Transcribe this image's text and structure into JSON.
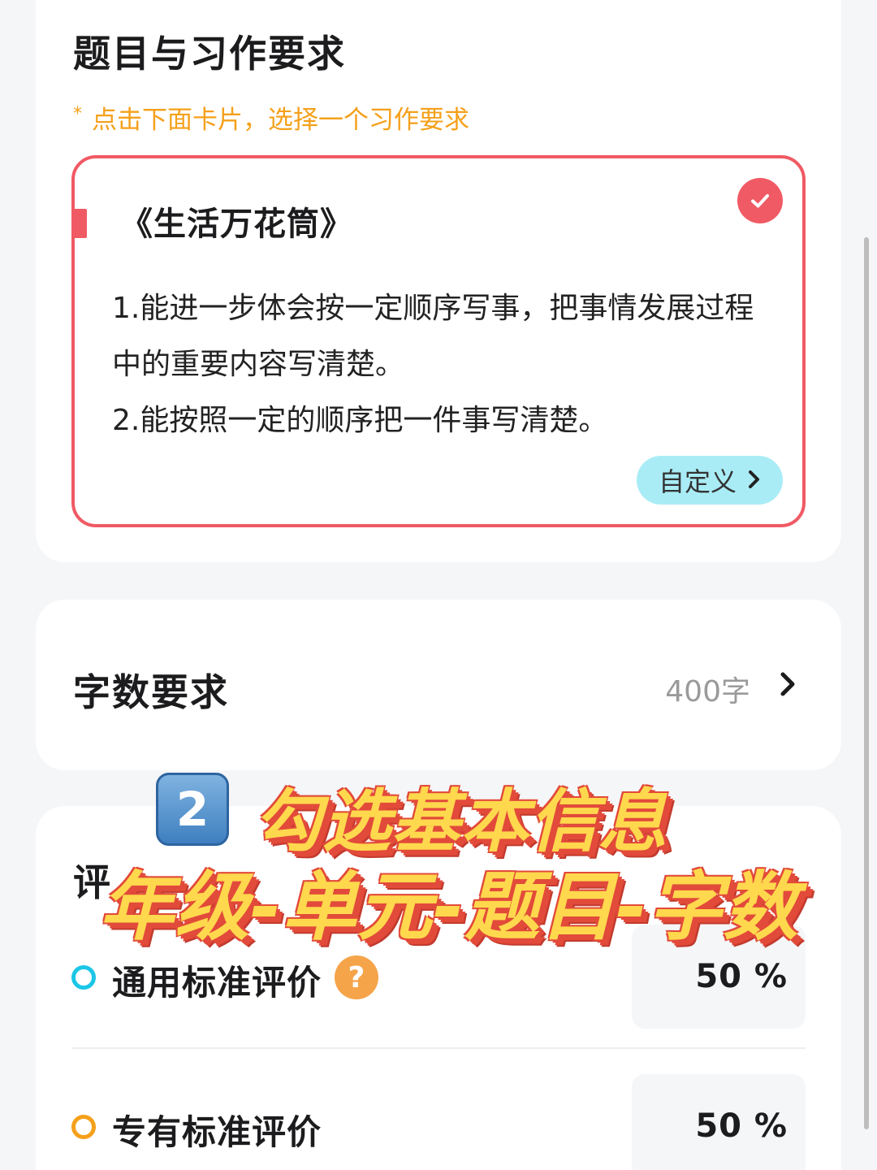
{
  "topic_section": {
    "title": "题目与习作要求",
    "hint_star": "*",
    "hint": "点击下面卡片，选择一个习作要求",
    "requirement_card": {
      "title": "《生活万花筒》",
      "line1": "1.能进一步体会按一定顺序写事，把事情发展过程中的重要内容写清楚。",
      "line2": "2.能按照一定的顺序把一件事写清楚。",
      "custom_label": "自定义",
      "selected": true
    }
  },
  "word_section": {
    "label": "字数要求",
    "value": "400字"
  },
  "eval_section": {
    "title": "评",
    "rows": [
      {
        "label": "通用标准评价",
        "percent": "50 %"
      },
      {
        "label": "专有标准评价",
        "percent": "50 %"
      }
    ]
  },
  "overlay": {
    "badge": "2",
    "line1": "勾选基本信息",
    "line2": "年级-单元-题目-字数"
  },
  "colors": {
    "accent": "#f05a64",
    "hint": "#f5a01a",
    "custom_button": "#a9ecf6",
    "dot_blue": "#1cc6e6",
    "dot_orange": "#f5a01a"
  }
}
